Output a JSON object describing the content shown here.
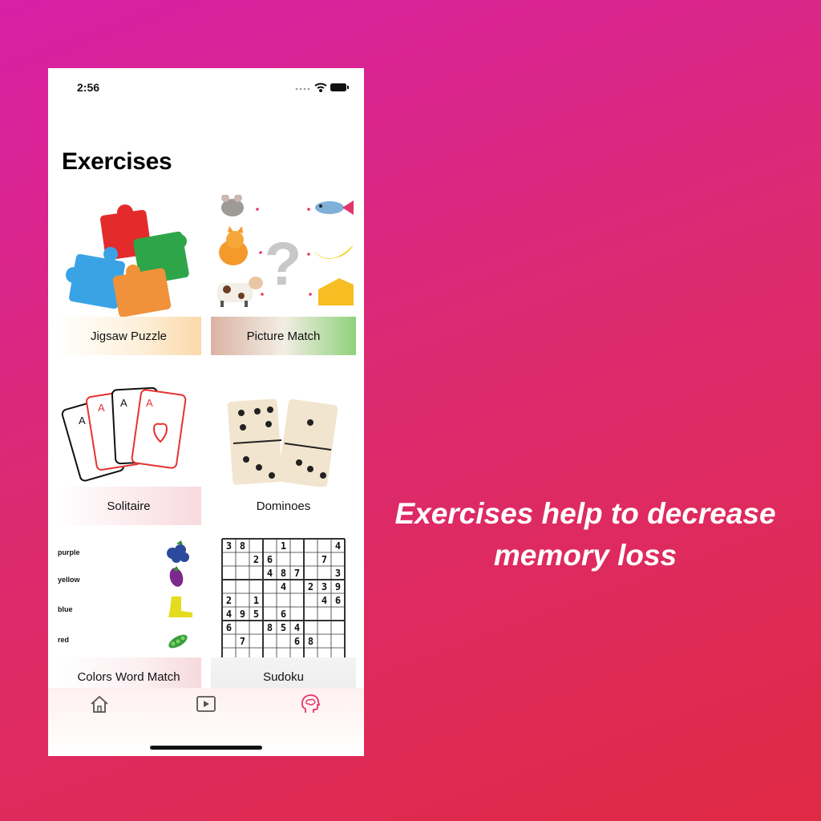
{
  "status_bar": {
    "time": "2:56"
  },
  "screen": {
    "title": "Exercises"
  },
  "exercises": [
    {
      "label": "Jigsaw Puzzle"
    },
    {
      "label": "Picture Match"
    },
    {
      "label": "Solitaire"
    },
    {
      "label": "Dominoes"
    },
    {
      "label": "Colors Word Match"
    },
    {
      "label": "Sudoku"
    }
  ],
  "color_words": [
    "purple",
    "yellow",
    "blue",
    "red"
  ],
  "sudoku_rows": [
    [
      "3",
      "8",
      "",
      "",
      "1",
      "",
      "",
      "",
      "4"
    ],
    [
      "",
      "",
      "2",
      "6",
      "",
      "",
      "",
      "7",
      ""
    ],
    [
      "",
      "",
      "",
      "4",
      "8",
      "7",
      "",
      "",
      "3"
    ],
    [
      "",
      "",
      "",
      "",
      "4",
      "",
      "2",
      "3",
      "9"
    ],
    [
      "2",
      "",
      "1",
      "",
      "",
      "",
      "",
      "4",
      "6"
    ],
    [
      "4",
      "9",
      "5",
      "",
      "6",
      "",
      "",
      "",
      ""
    ],
    [
      "6",
      "",
      "",
      "8",
      "5",
      "4",
      "",
      "",
      ""
    ],
    [
      "",
      "7",
      "",
      "",
      "",
      "6",
      "8",
      "",
      ""
    ]
  ],
  "tab_bar": {
    "items": [
      "home-icon",
      "video-icon",
      "brain-icon"
    ],
    "active": "brain-icon",
    "active_color": "#e8316b"
  },
  "caption": {
    "line1": "Exercises help to decrease",
    "line2": "memory loss"
  }
}
